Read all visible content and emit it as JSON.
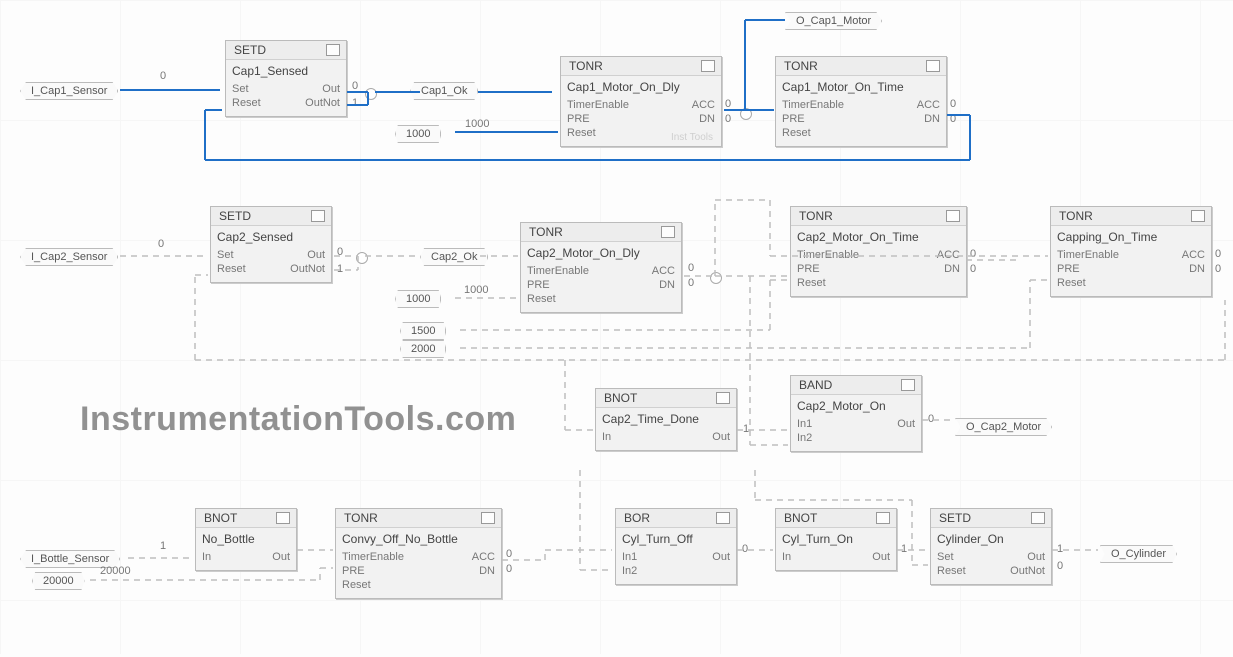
{
  "watermark": "InstrumentationTools.com",
  "watermark_block": "Inst Tools",
  "tags": {
    "i_cap1_sensor": "I_Cap1_Sensor",
    "i_cap2_sensor": "I_Cap2_Sensor",
    "i_bottle_sensor": "I_Bottle_Sensor",
    "cap1_ok": "Cap1_Ok",
    "cap2_ok": "Cap2_Ok",
    "o_cap1_motor": "O_Cap1_Motor",
    "o_cap2_motor": "O_Cap2_Motor",
    "o_cylinder": "O_Cylinder"
  },
  "consts": {
    "c1000a": "1000",
    "c1000b": "1000",
    "c1500": "1500",
    "c2000": "2000",
    "c20000": "20000"
  },
  "vals": {
    "cap1_sensor_wire": "0",
    "cap1_out": "0",
    "cap1_outnot": "1",
    "cap1_dly_pre": "1000",
    "cap1_dly_acc": "0",
    "cap1_dly_dn": "0",
    "cap1_time_acc": "0",
    "cap1_time_dn": "0",
    "cap2_sensor_wire": "0",
    "cap2_out": "0",
    "cap2_outnot": "1",
    "cap2_dly_pre": "1000",
    "cap2_dly_acc": "0",
    "cap2_dly_dn": "0",
    "cap2_time_acc": "0",
    "cap2_time_dn": "0",
    "capping_time_acc": "0",
    "capping_time_dn": "0",
    "bnot_timedone_out": "1",
    "band_motor_out": "0",
    "bottle_sensor_wire": "1",
    "convy_acc": "0",
    "convy_dn": "0",
    "bor_out": "0",
    "bnot_cyl_out": "1",
    "cyl_out": "1",
    "cyl_outnot": "0"
  },
  "blocks": {
    "setd1": {
      "type": "SETD",
      "name": "Cap1_Sensed",
      "rows": [
        [
          "Set",
          "Out"
        ],
        [
          "Reset",
          "OutNot"
        ]
      ]
    },
    "tonr1": {
      "type": "TONR",
      "name": "Cap1_Motor_On_Dly",
      "rows": [
        [
          "TimerEnable",
          "ACC"
        ],
        [
          "PRE",
          "DN"
        ],
        [
          "Reset",
          ""
        ]
      ]
    },
    "tonr2": {
      "type": "TONR",
      "name": "Cap1_Motor_On_Time",
      "rows": [
        [
          "TimerEnable",
          "ACC"
        ],
        [
          "PRE",
          "DN"
        ],
        [
          "Reset",
          ""
        ]
      ]
    },
    "setd2": {
      "type": "SETD",
      "name": "Cap2_Sensed",
      "rows": [
        [
          "Set",
          "Out"
        ],
        [
          "Reset",
          "OutNot"
        ]
      ]
    },
    "tonr3": {
      "type": "TONR",
      "name": "Cap2_Motor_On_Dly",
      "rows": [
        [
          "TimerEnable",
          "ACC"
        ],
        [
          "PRE",
          "DN"
        ],
        [
          "Reset",
          ""
        ]
      ]
    },
    "tonr4": {
      "type": "TONR",
      "name": "Cap2_Motor_On_Time",
      "rows": [
        [
          "TimerEnable",
          "ACC"
        ],
        [
          "PRE",
          "DN"
        ],
        [
          "Reset",
          ""
        ]
      ]
    },
    "tonr5": {
      "type": "TONR",
      "name": "Capping_On_Time",
      "rows": [
        [
          "TimerEnable",
          "ACC"
        ],
        [
          "PRE",
          "DN"
        ],
        [
          "Reset",
          ""
        ]
      ]
    },
    "bnot1": {
      "type": "BNOT",
      "name": "Cap2_Time_Done",
      "rows": [
        [
          "In",
          "Out"
        ]
      ]
    },
    "band1": {
      "type": "BAND",
      "name": "Cap2_Motor_On",
      "rows": [
        [
          "In1",
          "Out"
        ],
        [
          "In2",
          ""
        ]
      ]
    },
    "bnot2": {
      "type": "BNOT",
      "name": "No_Bottle",
      "rows": [
        [
          "In",
          "Out"
        ]
      ]
    },
    "tonr6": {
      "type": "TONR",
      "name": "Convy_Off_No_Bottle",
      "rows": [
        [
          "TimerEnable",
          "ACC"
        ],
        [
          "PRE",
          "DN"
        ],
        [
          "Reset",
          ""
        ]
      ]
    },
    "bor1": {
      "type": "BOR",
      "name": "Cyl_Turn_Off",
      "rows": [
        [
          "In1",
          "Out"
        ],
        [
          "In2",
          ""
        ]
      ]
    },
    "bnot3": {
      "type": "BNOT",
      "name": "Cyl_Turn_On",
      "rows": [
        [
          "In",
          "Out"
        ]
      ]
    },
    "setd3": {
      "type": "SETD",
      "name": "Cylinder_On",
      "rows": [
        [
          "Set",
          "Out"
        ],
        [
          "Reset",
          "OutNot"
        ]
      ]
    }
  }
}
